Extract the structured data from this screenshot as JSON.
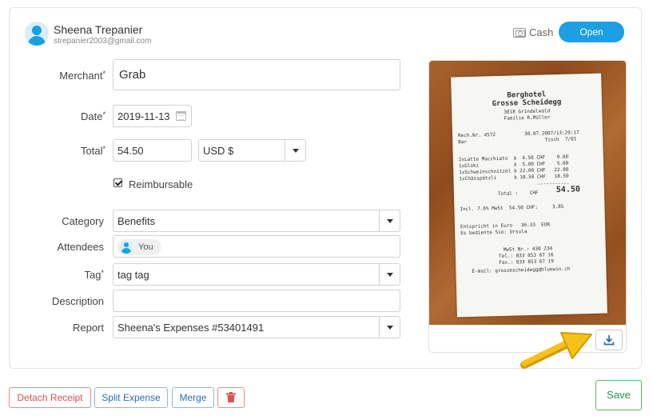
{
  "user": {
    "name": "Sheena Trepanier",
    "email": "strepanier2003@gmail.com"
  },
  "payment": {
    "method_label": "Cash",
    "method_icon": "cash-icon",
    "status_label": "Open",
    "status_color": "#1c9fe5"
  },
  "form": {
    "merchant": {
      "label": "Merchant",
      "required": "*",
      "value": "Grab"
    },
    "date": {
      "label": "Date",
      "required": "*",
      "value": "2019-11-13"
    },
    "total": {
      "label": "Total",
      "required": "*",
      "value": "54.50",
      "currency": "USD $"
    },
    "reimbursable": {
      "label": "Reimbursable",
      "checked": true
    },
    "category": {
      "label": "Category",
      "value": "Benefits"
    },
    "attendees": {
      "label": "Attendees",
      "chips": [
        "You"
      ]
    },
    "tag": {
      "label": "Tag",
      "required": "*",
      "value": "tag tag"
    },
    "description": {
      "label": "Description",
      "value": ""
    },
    "report": {
      "label": "Report",
      "value": "Sheena's Expenses #53401491"
    }
  },
  "receipt": {
    "lines": {
      "l1": "Berghotel",
      "l2": "Grosse Scheidegg",
      "l3": "3818 Grindelwald",
      "l4": "Familie R.Müller",
      "l5": "Rech.Nr. 4572          30.07.2007/13:29:17",
      "l6": "Bar                           Tisch  7/01",
      "l7": "2xLatte Macchiato  à  4.50 CHF    9.00",
      "l8": "1xGloki            à  5.00 CHF    5.00",
      "l9": "1xSchweinschnitzel à 22.00 CHF   22.00",
      "l10": "1xChässpätzli      à 18.50 CHF   18.50",
      "l11": "Total :    CHF",
      "l12": "54.50",
      "l13": "Incl. 7.6% MwSt  54.50 CHF:     3.85",
      "l14": "Entspricht in Euro   36.33  EUR",
      "l15": "Es bediente Sie: Ursula",
      "l16": "MwSt Nr.: 430 234",
      "l17": "Tel.: 033 853 67 16",
      "l18": "Fax.: 033 853 67 19",
      "l19": "E-mail: grossescheidegg@bluewin.ch"
    },
    "download_icon": "download-icon"
  },
  "actions": {
    "detach": "Detach Receipt",
    "split": "Split Expense",
    "merge": "Merge",
    "delete_icon": "trash-icon",
    "save": "Save"
  }
}
